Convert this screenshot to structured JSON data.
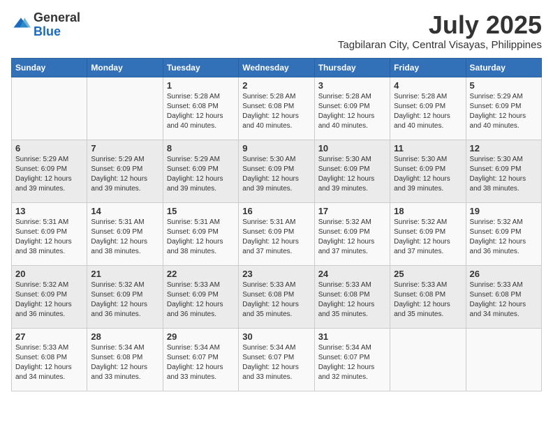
{
  "logo": {
    "general": "General",
    "blue": "Blue"
  },
  "title": "July 2025",
  "location": "Tagbilaran City, Central Visayas, Philippines",
  "days_of_week": [
    "Sunday",
    "Monday",
    "Tuesday",
    "Wednesday",
    "Thursday",
    "Friday",
    "Saturday"
  ],
  "weeks": [
    [
      {
        "day": "",
        "info": ""
      },
      {
        "day": "",
        "info": ""
      },
      {
        "day": "1",
        "info": "Sunrise: 5:28 AM\nSunset: 6:08 PM\nDaylight: 12 hours and 40 minutes."
      },
      {
        "day": "2",
        "info": "Sunrise: 5:28 AM\nSunset: 6:08 PM\nDaylight: 12 hours and 40 minutes."
      },
      {
        "day": "3",
        "info": "Sunrise: 5:28 AM\nSunset: 6:09 PM\nDaylight: 12 hours and 40 minutes."
      },
      {
        "day": "4",
        "info": "Sunrise: 5:28 AM\nSunset: 6:09 PM\nDaylight: 12 hours and 40 minutes."
      },
      {
        "day": "5",
        "info": "Sunrise: 5:29 AM\nSunset: 6:09 PM\nDaylight: 12 hours and 40 minutes."
      }
    ],
    [
      {
        "day": "6",
        "info": "Sunrise: 5:29 AM\nSunset: 6:09 PM\nDaylight: 12 hours and 39 minutes."
      },
      {
        "day": "7",
        "info": "Sunrise: 5:29 AM\nSunset: 6:09 PM\nDaylight: 12 hours and 39 minutes."
      },
      {
        "day": "8",
        "info": "Sunrise: 5:29 AM\nSunset: 6:09 PM\nDaylight: 12 hours and 39 minutes."
      },
      {
        "day": "9",
        "info": "Sunrise: 5:30 AM\nSunset: 6:09 PM\nDaylight: 12 hours and 39 minutes."
      },
      {
        "day": "10",
        "info": "Sunrise: 5:30 AM\nSunset: 6:09 PM\nDaylight: 12 hours and 39 minutes."
      },
      {
        "day": "11",
        "info": "Sunrise: 5:30 AM\nSunset: 6:09 PM\nDaylight: 12 hours and 39 minutes."
      },
      {
        "day": "12",
        "info": "Sunrise: 5:30 AM\nSunset: 6:09 PM\nDaylight: 12 hours and 38 minutes."
      }
    ],
    [
      {
        "day": "13",
        "info": "Sunrise: 5:31 AM\nSunset: 6:09 PM\nDaylight: 12 hours and 38 minutes."
      },
      {
        "day": "14",
        "info": "Sunrise: 5:31 AM\nSunset: 6:09 PM\nDaylight: 12 hours and 38 minutes."
      },
      {
        "day": "15",
        "info": "Sunrise: 5:31 AM\nSunset: 6:09 PM\nDaylight: 12 hours and 38 minutes."
      },
      {
        "day": "16",
        "info": "Sunrise: 5:31 AM\nSunset: 6:09 PM\nDaylight: 12 hours and 37 minutes."
      },
      {
        "day": "17",
        "info": "Sunrise: 5:32 AM\nSunset: 6:09 PM\nDaylight: 12 hours and 37 minutes."
      },
      {
        "day": "18",
        "info": "Sunrise: 5:32 AM\nSunset: 6:09 PM\nDaylight: 12 hours and 37 minutes."
      },
      {
        "day": "19",
        "info": "Sunrise: 5:32 AM\nSunset: 6:09 PM\nDaylight: 12 hours and 36 minutes."
      }
    ],
    [
      {
        "day": "20",
        "info": "Sunrise: 5:32 AM\nSunset: 6:09 PM\nDaylight: 12 hours and 36 minutes."
      },
      {
        "day": "21",
        "info": "Sunrise: 5:32 AM\nSunset: 6:09 PM\nDaylight: 12 hours and 36 minutes."
      },
      {
        "day": "22",
        "info": "Sunrise: 5:33 AM\nSunset: 6:09 PM\nDaylight: 12 hours and 36 minutes."
      },
      {
        "day": "23",
        "info": "Sunrise: 5:33 AM\nSunset: 6:08 PM\nDaylight: 12 hours and 35 minutes."
      },
      {
        "day": "24",
        "info": "Sunrise: 5:33 AM\nSunset: 6:08 PM\nDaylight: 12 hours and 35 minutes."
      },
      {
        "day": "25",
        "info": "Sunrise: 5:33 AM\nSunset: 6:08 PM\nDaylight: 12 hours and 35 minutes."
      },
      {
        "day": "26",
        "info": "Sunrise: 5:33 AM\nSunset: 6:08 PM\nDaylight: 12 hours and 34 minutes."
      }
    ],
    [
      {
        "day": "27",
        "info": "Sunrise: 5:33 AM\nSunset: 6:08 PM\nDaylight: 12 hours and 34 minutes."
      },
      {
        "day": "28",
        "info": "Sunrise: 5:34 AM\nSunset: 6:08 PM\nDaylight: 12 hours and 33 minutes."
      },
      {
        "day": "29",
        "info": "Sunrise: 5:34 AM\nSunset: 6:07 PM\nDaylight: 12 hours and 33 minutes."
      },
      {
        "day": "30",
        "info": "Sunrise: 5:34 AM\nSunset: 6:07 PM\nDaylight: 12 hours and 33 minutes."
      },
      {
        "day": "31",
        "info": "Sunrise: 5:34 AM\nSunset: 6:07 PM\nDaylight: 12 hours and 32 minutes."
      },
      {
        "day": "",
        "info": ""
      },
      {
        "day": "",
        "info": ""
      }
    ]
  ]
}
